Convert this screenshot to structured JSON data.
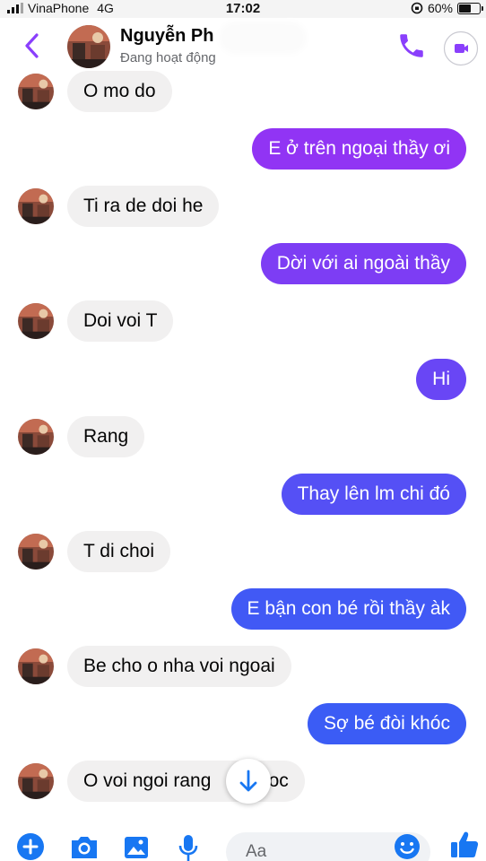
{
  "status_bar": {
    "carrier": "VinaPhone",
    "network": "4G",
    "time": "17:02",
    "battery": "60%",
    "battery_level": 0.6
  },
  "header": {
    "back_icon": "chevron-left-icon",
    "name": "Nguyễn Ph",
    "status": "Đang hoạt động",
    "call_icon": "phone-icon",
    "video_icon": "video-camera-icon"
  },
  "colors": {
    "accent": "#8a3ffc",
    "incoming_bubble": "#f1f0f0",
    "outgoing_top": "#9b2ff4",
    "outgoing_bottom": "#3b5cf5"
  },
  "messages": [
    {
      "side": "in",
      "text": "O mo do"
    },
    {
      "side": "out",
      "text": "E ở trên ngoại thầy ơi"
    },
    {
      "side": "in",
      "text": "Ti ra de doi he"
    },
    {
      "side": "out",
      "text": "Dời với ai ngoài thầy"
    },
    {
      "side": "in",
      "text": "Doi voi T"
    },
    {
      "side": "out",
      "text": "Hi"
    },
    {
      "side": "in",
      "text": "Rang"
    },
    {
      "side": "out",
      "text": "Thay lên lm chi đó"
    },
    {
      "side": "in",
      "text": "T di choi"
    },
    {
      "side": "out",
      "text": "E bận con bé rồi thầy àk"
    },
    {
      "side": "in",
      "text": "Be cho o nha voi ngoai"
    },
    {
      "side": "out",
      "text": "Sợ bé đòi khóc"
    },
    {
      "side": "in",
      "text": "O voi ngoi rang       duoc"
    }
  ],
  "scroll_button": {
    "icon": "arrow-down-icon"
  },
  "composer": {
    "placeholder": "Aa",
    "icons": [
      "plus-circle-icon",
      "camera-icon",
      "image-icon",
      "microphone-icon",
      "emoji-icon",
      "thumbs-up-icon"
    ]
  }
}
